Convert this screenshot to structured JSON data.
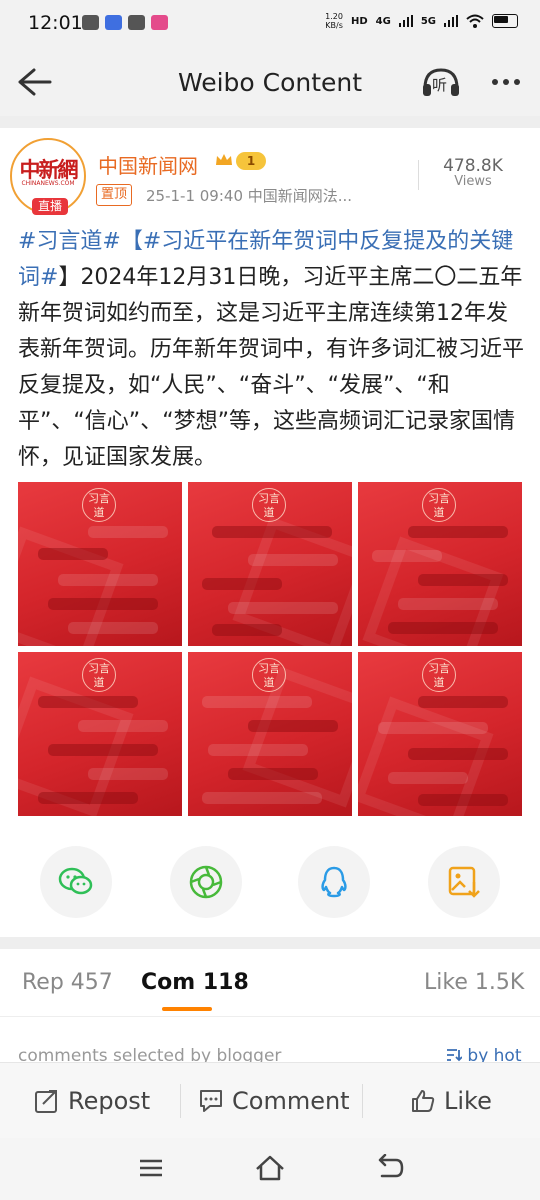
{
  "status_bar": {
    "time": "12:01",
    "net_speed_value": "1.20",
    "net_speed_unit": "KB/s",
    "hd_label": "HD",
    "signal_4g": "4G",
    "signal_5g": "5G",
    "apps": [
      {
        "icon": "wechat-icon",
        "label": "",
        "color": "#555555"
      },
      {
        "icon": "app-icon-blue",
        "label": "",
        "color": "#3f6fe0"
      },
      {
        "icon": "mail-icon",
        "label": "",
        "color": "#555555"
      },
      {
        "icon": "app-icon-pink",
        "label": "",
        "color": "#e44b8b"
      }
    ]
  },
  "header": {
    "title": "Weibo Content",
    "listen_label": "听"
  },
  "post": {
    "author": "中国新闻网",
    "avatar_logo": "中新網",
    "avatar_sub": "CHINANEWS.COM",
    "live_badge": "直播",
    "level": "1",
    "pinned": "置顶",
    "meta": "25-1-1 09:40   中国新闻网法...",
    "views": "478.8K",
    "views_label": "Views",
    "hashtag1": "#习言道#",
    "hashtag2": "【#习近平在新年贺词中反复提及的关键词#",
    "body": "】2024年12月31日晚，习近平主席二〇二五年新年贺词如约而至，这是习近平主席连续第12年发表新年贺词。历年新年贺词中，有许多词汇被习近平反复提及，如“人民”、“奋斗”、“发展”、“和平”、“信心”、“梦想”等，这些高频词汇记录家国情怀，见证国家发展。",
    "images": [
      {
        "seal": "习言道"
      },
      {
        "seal": "习言道"
      },
      {
        "seal": "习言道"
      },
      {
        "seal": "习言道"
      },
      {
        "seal": "习言道"
      },
      {
        "seal": "习言道"
      }
    ]
  },
  "share": [
    {
      "name": "wechat-share",
      "icon": "wechat-icon",
      "color": "#2fbf57"
    },
    {
      "name": "moments-share",
      "icon": "moments-icon",
      "color": "#47b93a"
    },
    {
      "name": "qq-share",
      "icon": "qq-icon",
      "color": "#2a9be6"
    },
    {
      "name": "save-image-share",
      "icon": "image-save-icon",
      "color": "#f0a21a"
    }
  ],
  "tabs": {
    "repost": "Rep 457",
    "comment": "Com 118",
    "like": "Like 1.5K"
  },
  "comments": {
    "selected_label": "comments selected by blogger",
    "sort_label": "by hot"
  },
  "actions": {
    "repost": "Repost",
    "comment": "Comment",
    "like": "Like"
  },
  "colors": {
    "accent": "#ff8200",
    "hashtag": "#3a6fb5",
    "author": "#e86a22",
    "post_image_red": "#d4252b"
  }
}
